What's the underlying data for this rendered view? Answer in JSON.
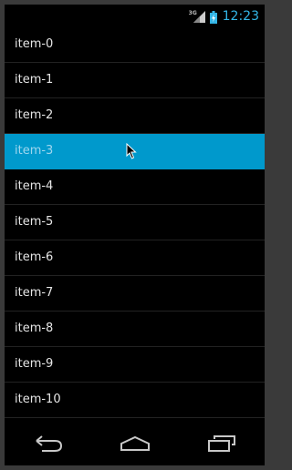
{
  "status_bar": {
    "network": "3G",
    "time": "12:23",
    "accent_color": "#33b5e5",
    "icons": [
      "signal-icon",
      "battery-icon"
    ]
  },
  "list": {
    "items": [
      {
        "label": "item-0"
      },
      {
        "label": "item-1"
      },
      {
        "label": "item-2"
      },
      {
        "label": "item-3",
        "selected": true
      },
      {
        "label": "item-4"
      },
      {
        "label": "item-5"
      },
      {
        "label": "item-6"
      },
      {
        "label": "item-7"
      },
      {
        "label": "item-8"
      },
      {
        "label": "item-9"
      },
      {
        "label": "item-10"
      }
    ],
    "selected_color": "#0099cc"
  },
  "nav_bar": {
    "buttons": [
      "back-icon",
      "home-icon",
      "recent-apps-icon"
    ]
  }
}
